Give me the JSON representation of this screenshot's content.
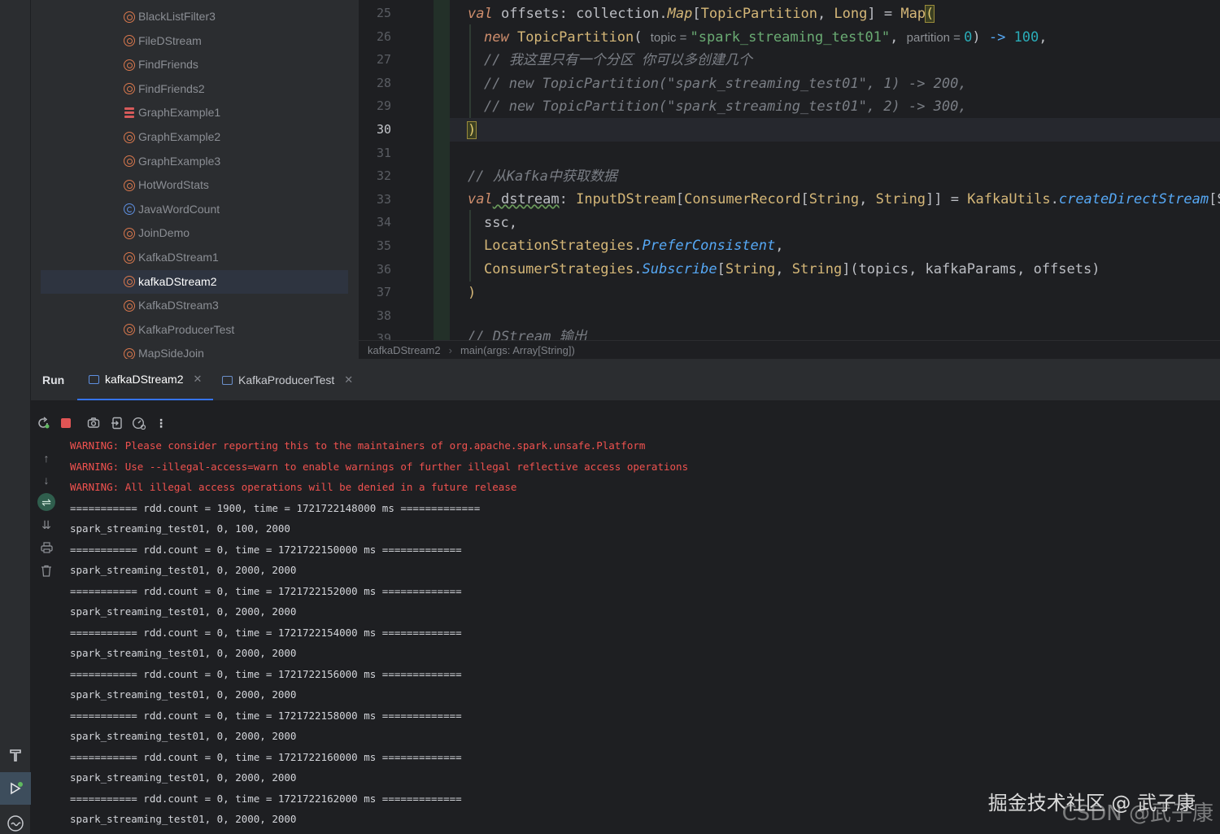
{
  "project_tree": {
    "items": [
      {
        "label": "BlackListFilter3",
        "icon": "object-icon"
      },
      {
        "label": "FileDStream",
        "icon": "object-icon"
      },
      {
        "label": "FindFriends",
        "icon": "object-icon"
      },
      {
        "label": "FindFriends2",
        "icon": "object-icon"
      },
      {
        "label": "GraphExample1",
        "icon": "stack-icon"
      },
      {
        "label": "GraphExample2",
        "icon": "object-icon"
      },
      {
        "label": "GraphExample3",
        "icon": "object-icon"
      },
      {
        "label": "HotWordStats",
        "icon": "object-icon"
      },
      {
        "label": "JavaWordCount",
        "icon": "class-icon"
      },
      {
        "label": "JoinDemo",
        "icon": "object-icon"
      },
      {
        "label": "KafkaDStream1",
        "icon": "object-icon"
      },
      {
        "label": "kafkaDStream2",
        "icon": "object-icon",
        "selected": true
      },
      {
        "label": "KafkaDStream3",
        "icon": "object-icon"
      },
      {
        "label": "KafkaProducerTest",
        "icon": "object-icon"
      },
      {
        "label": "MapSideJoin",
        "icon": "object-icon"
      }
    ]
  },
  "editor": {
    "line_numbers": [
      "25",
      "26",
      "27",
      "28",
      "29",
      "30",
      "31",
      "32",
      "33",
      "34",
      "35",
      "36",
      "37",
      "38",
      "39"
    ],
    "current_line": "30",
    "code": {
      "l25": {
        "kw": "val",
        "name": " offsets",
        "colon": ": collection.",
        "map": "Map",
        "br1": "[",
        "t1": "TopicPartition",
        "comma": ", ",
        "t2": "Long",
        "br2": "] = ",
        "mapcall": "Map",
        "paren": "("
      },
      "l26": {
        "kw": "new",
        "cls": " TopicPartition",
        "open": "( ",
        "hint1": "topic = ",
        "s1": "\"spark_streaming_test01\"",
        "comma": ", ",
        "hint2": "partition = ",
        "n1": "0",
        "close": ") ",
        "arrow": "-> ",
        "n2": "100",
        "end": ","
      },
      "l27": "// 我这里只有一个分区 你可以多创建几个",
      "l28": "// new TopicPartition(\"spark_streaming_test01\", 1) -> 200,",
      "l29": "// new TopicPartition(\"spark_streaming_test01\", 2) -> 300,",
      "l30": ")",
      "l32": "// 从Kafka中获取数据",
      "l33": {
        "kw": "val",
        "name": " dstream",
        "colon": ": ",
        "t1": "InputDStream",
        "b1": "[",
        "t2": "ConsumerRecord",
        "b2": "[",
        "t3": "String",
        "c1": ", ",
        "t4": "String",
        "b3": "]] = ",
        "obj": "KafkaUtils",
        "dot": ".",
        "fn": "createDirectStream",
        "tail": "[S"
      },
      "l34": "ssc,",
      "l35": {
        "obj": "LocationStrategies",
        "dot": ".",
        "fn": "PreferConsistent",
        "end": ","
      },
      "l36": {
        "obj": "ConsumerStrategies",
        "dot": ".",
        "fn": "Subscribe",
        "b1": "[",
        "t1": "String",
        "c": ", ",
        "t2": "String",
        "b2": "](topics, kafkaParams, offsets)"
      },
      "l37": ")",
      "l39": "// DStream 输出"
    }
  },
  "breadcrumb": {
    "file": "kafkaDStream2",
    "method": "main(args: Array[String])"
  },
  "run_panel": {
    "title": "Run",
    "tabs": [
      {
        "label": "kafkaDStream2",
        "active": true
      },
      {
        "label": "KafkaProducerTest",
        "active": false
      }
    ],
    "console_lines": [
      {
        "text": "WARNING: Please consider reporting this to the maintainers of org.apache.spark.unsafe.Platform",
        "type": "warn"
      },
      {
        "text": "WARNING: Use --illegal-access=warn to enable warnings of further illegal reflective access operations",
        "type": "warn"
      },
      {
        "text": "WARNING: All illegal access operations will be denied in a future release",
        "type": "warn"
      },
      {
        "text": "=========== rdd.count = 1900, time = 1721722148000 ms =============",
        "type": "out"
      },
      {
        "text": "spark_streaming_test01, 0, 100, 2000",
        "type": "out"
      },
      {
        "text": "=========== rdd.count = 0, time = 1721722150000 ms =============",
        "type": "out"
      },
      {
        "text": "spark_streaming_test01, 0, 2000, 2000",
        "type": "out"
      },
      {
        "text": "=========== rdd.count = 0, time = 1721722152000 ms =============",
        "type": "out"
      },
      {
        "text": "spark_streaming_test01, 0, 2000, 2000",
        "type": "out"
      },
      {
        "text": "=========== rdd.count = 0, time = 1721722154000 ms =============",
        "type": "out"
      },
      {
        "text": "spark_streaming_test01, 0, 2000, 2000",
        "type": "out"
      },
      {
        "text": "=========== rdd.count = 0, time = 1721722156000 ms =============",
        "type": "out"
      },
      {
        "text": "spark_streaming_test01, 0, 2000, 2000",
        "type": "out"
      },
      {
        "text": "=========== rdd.count = 0, time = 1721722158000 ms =============",
        "type": "out"
      },
      {
        "text": "spark_streaming_test01, 0, 2000, 2000",
        "type": "out"
      },
      {
        "text": "=========== rdd.count = 0, time = 1721722160000 ms =============",
        "type": "out"
      },
      {
        "text": "spark_streaming_test01, 0, 2000, 2000",
        "type": "out"
      },
      {
        "text": "=========== rdd.count = 0, time = 1721722162000 ms =============",
        "type": "out"
      },
      {
        "text": "spark_streaming_test01, 0, 2000, 2000",
        "type": "out"
      }
    ]
  },
  "watermark": {
    "line1": "掘金技术社区 @ 武子康",
    "line2": "CSDN @武子康"
  },
  "colors": {
    "warning": "#f0524f",
    "accent": "#3574f0",
    "object_icon": "#d9784d",
    "class_icon": "#5e8fe0"
  }
}
